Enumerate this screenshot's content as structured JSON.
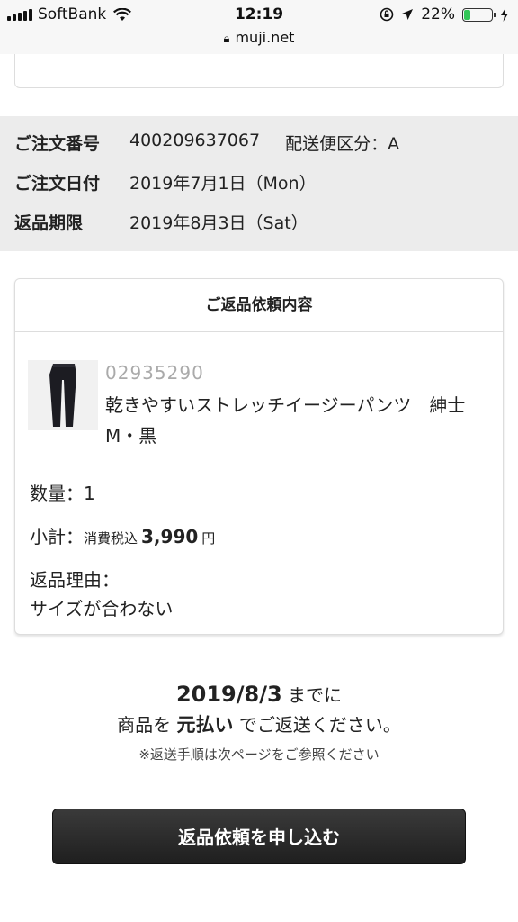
{
  "status_bar": {
    "carrier": "SoftBank",
    "time": "12:19",
    "battery_percent": "22%",
    "icons": [
      "signal-icon",
      "wifi-icon",
      "orientation-lock-icon",
      "location-icon",
      "battery-icon",
      "charging-icon"
    ]
  },
  "url_bar": {
    "domain": "muji.net"
  },
  "order_info": {
    "order_number_label": "ご注文番号",
    "order_number": "400209637067",
    "delivery_type": "配送便区分：A",
    "order_date_label": "ご注文日付",
    "order_date": "2019年7月1日（Mon）",
    "return_deadline_label": "返品期限",
    "return_deadline": "2019年8月3日（Sat）"
  },
  "return_request": {
    "title": "ご返品依頼内容",
    "item": {
      "code": "02935290",
      "name": "乾きやすいストレッチイージーパンツ　紳士",
      "variant": "M・黒"
    },
    "quantity": "数量：1",
    "subtotal_label": "小計：",
    "subtotal_tax": "消費税込",
    "subtotal_amount": "3,990",
    "subtotal_currency": "円",
    "reason_label": "返品理由：",
    "reason_value": "サイズが合わない"
  },
  "deadline_notice": {
    "date": "2019/8/3",
    "suffix": " までに",
    "method_prefix": "商品を ",
    "method_bold": "元払い",
    "method_suffix": " でご返送ください。",
    "note": "※返送手順は次ページをご参照ください"
  },
  "submit_button": {
    "label": "返品依頼を申し込む"
  },
  "colors": {
    "accent_red": "#c0001a",
    "battery_green": "#34c759",
    "button_dark": "#2a2a2a",
    "info_bg": "#ececec"
  }
}
